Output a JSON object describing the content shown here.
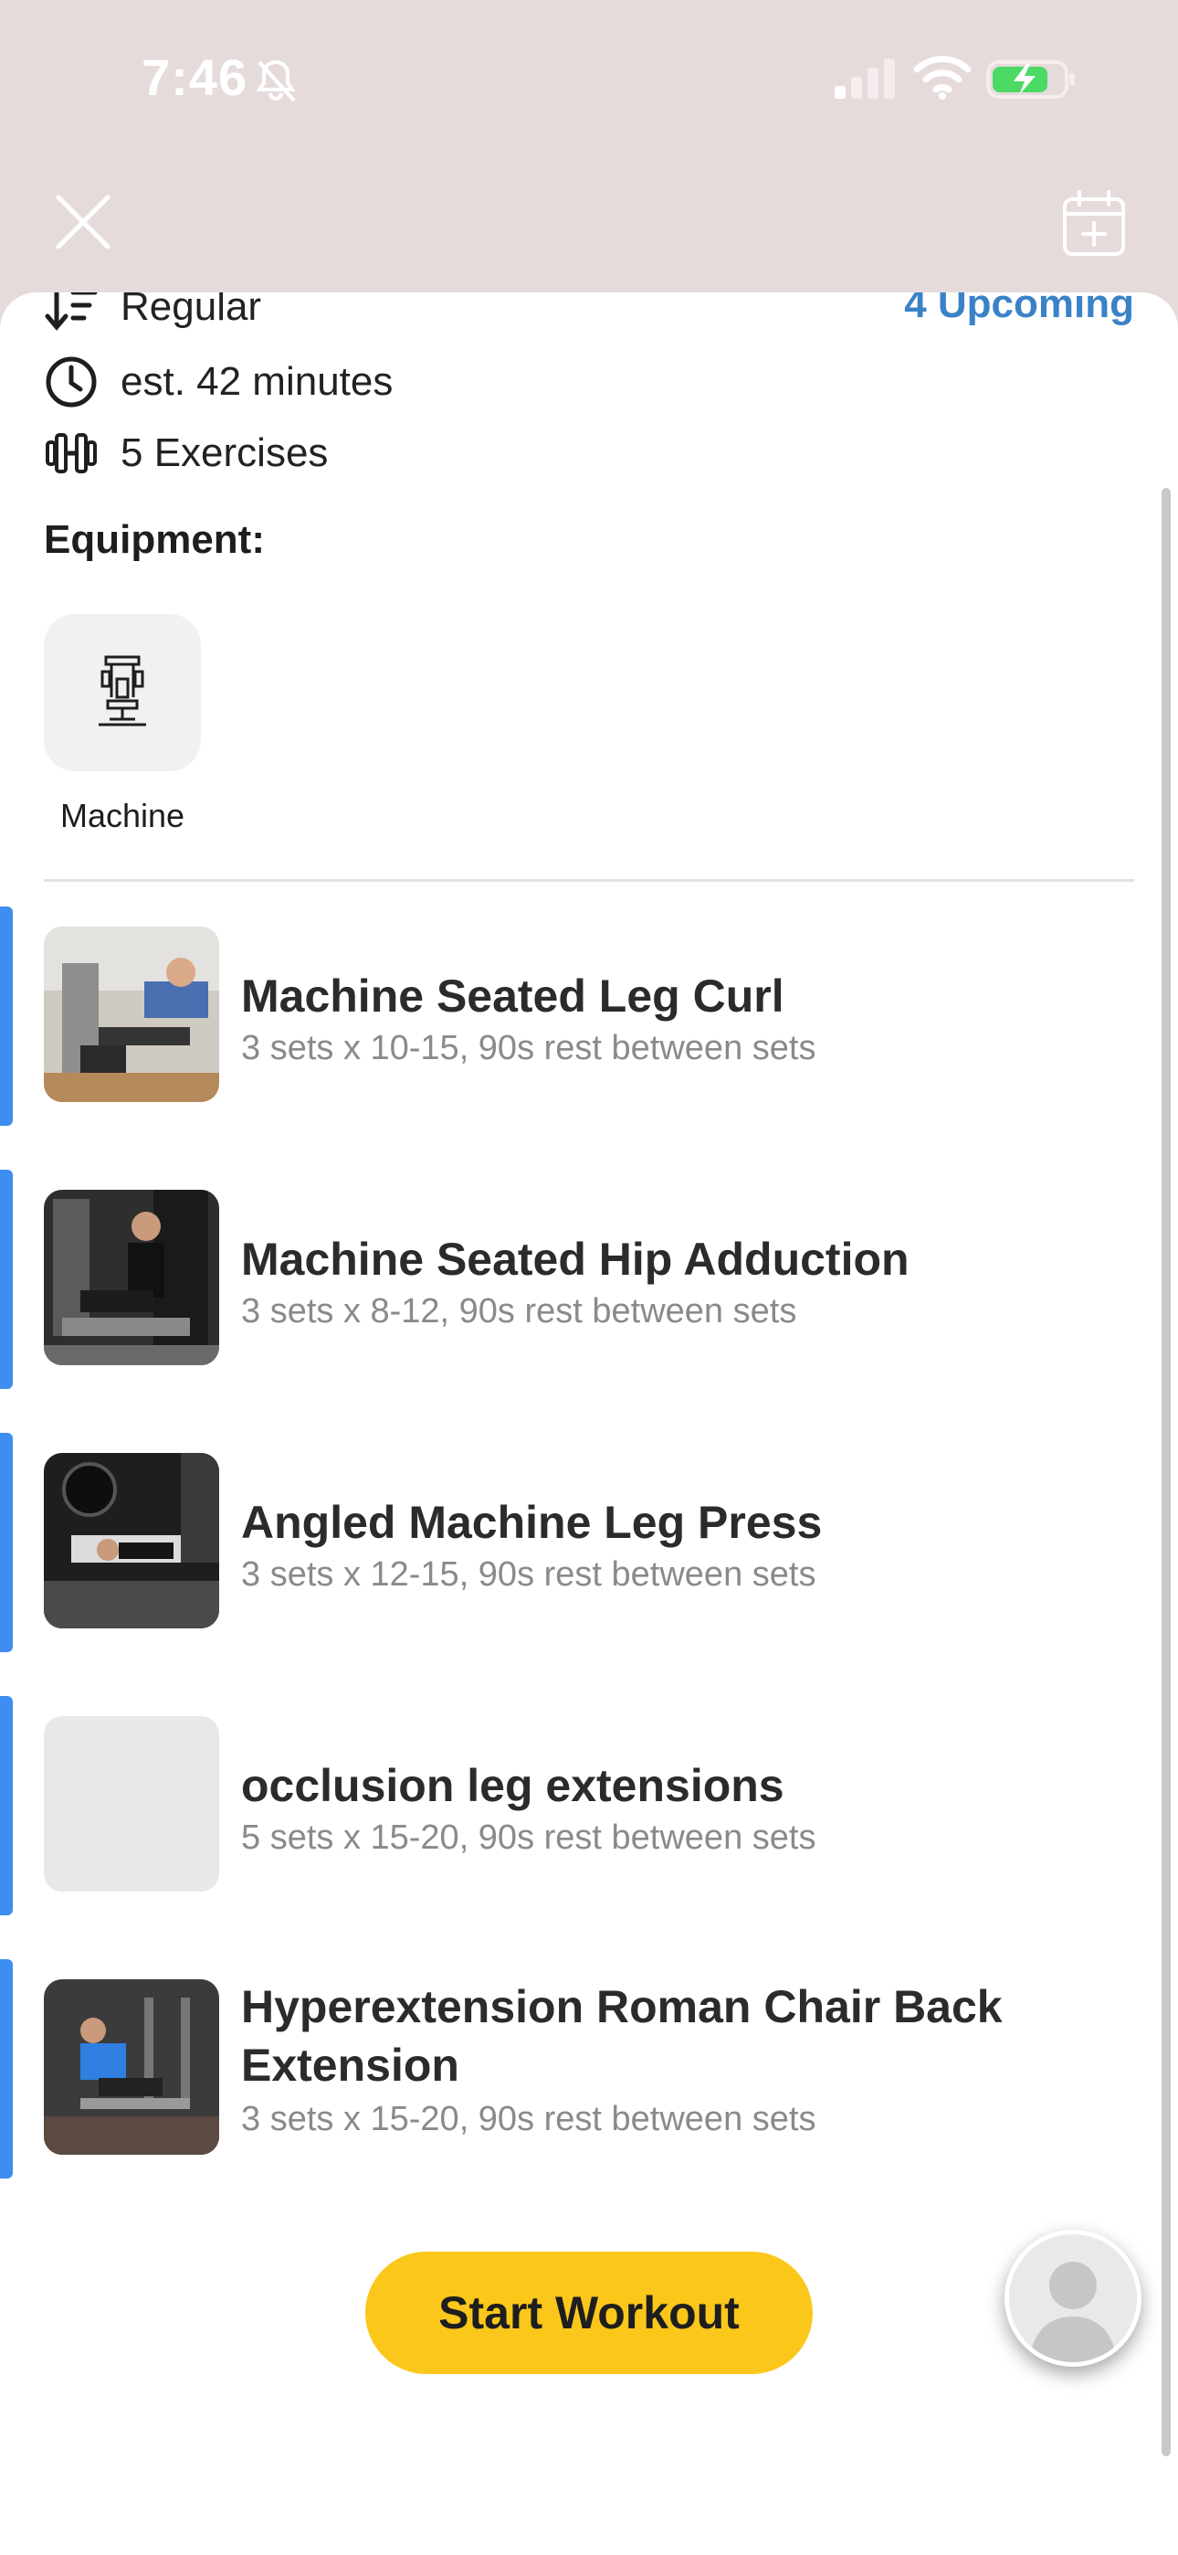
{
  "status_bar": {
    "time": "7:46",
    "icons": [
      "bell-slash-icon",
      "cellular-signal-icon",
      "wifi-icon",
      "battery-charging-icon"
    ]
  },
  "header": {
    "close_icon": "close-icon",
    "calendar_icon": "calendar-add-icon"
  },
  "summary": {
    "type_label": "Regular",
    "upcoming_label": "4 Upcoming",
    "duration_label": "est. 42 minutes",
    "exercises_label": "5 Exercises"
  },
  "equipment": {
    "title": "Equipment:",
    "items": [
      {
        "label": "Machine",
        "icon": "machine-icon"
      }
    ]
  },
  "exercises": [
    {
      "name": "Machine Seated Leg Curl",
      "detail": "3 sets x 10-15, 90s rest between sets"
    },
    {
      "name": "Machine Seated Hip Adduction",
      "detail": "3 sets x 8-12, 90s rest between sets"
    },
    {
      "name": "Angled Machine Leg Press",
      "detail": "3 sets x 12-15, 90s rest between sets"
    },
    {
      "name": "occlusion leg extensions",
      "detail": "5 sets x 15-20, 90s rest between sets"
    },
    {
      "name": "Hyperextension Roman Chair Back Extension",
      "detail": "3 sets x 15-20, 90s rest between sets"
    }
  ],
  "actions": {
    "start_workout_label": "Start Workout"
  },
  "colors": {
    "accent_blue": "#3d8ef0",
    "upcoming_blue": "#3a82c7",
    "start_button": "#fcc71b",
    "header_background": "#e6dbdb"
  }
}
